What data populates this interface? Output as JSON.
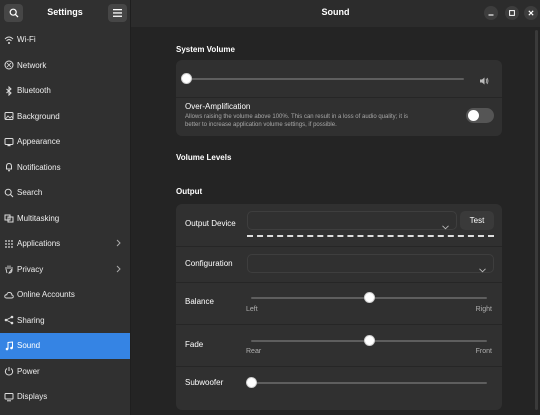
{
  "sidebar": {
    "title": "Settings",
    "items": [
      {
        "label": "Wi-Fi",
        "icon": "wifi-icon"
      },
      {
        "label": "Network",
        "icon": "network-icon"
      },
      {
        "label": "Bluetooth",
        "icon": "bluetooth-icon"
      },
      {
        "label": "Background",
        "icon": "background-icon"
      },
      {
        "label": "Appearance",
        "icon": "appearance-icon"
      },
      {
        "label": "Notifications",
        "icon": "bell-icon"
      },
      {
        "label": "Search",
        "icon": "search-icon"
      },
      {
        "label": "Multitasking",
        "icon": "multitasking-icon"
      },
      {
        "label": "Applications",
        "icon": "apps-grid-icon"
      },
      {
        "label": "Privacy",
        "icon": "hand-icon"
      },
      {
        "label": "Online Accounts",
        "icon": "cloud-icon"
      },
      {
        "label": "Sharing",
        "icon": "share-icon"
      },
      {
        "label": "Sound",
        "icon": "music-note-icon"
      },
      {
        "label": "Power",
        "icon": "power-icon"
      },
      {
        "label": "Displays",
        "icon": "display-icon"
      }
    ],
    "active": "Sound"
  },
  "window": {
    "title": "Sound"
  },
  "system_volume": {
    "heading": "System Volume",
    "level": 0,
    "over_amp_title": "Over-Amplification",
    "over_amp_desc_1": "Allows raising the volume above 100%. This can result in a loss of audio quality; it is",
    "over_amp_desc_2": "better to increase application volume settings, if possible.",
    "over_amp_enabled": false
  },
  "volume_levels": {
    "heading": "Volume Levels"
  },
  "output": {
    "heading": "Output",
    "device_label": "Output Device",
    "device_value": "",
    "test_label": "Test",
    "config_label": "Configuration",
    "config_value": "",
    "balance_label": "Balance",
    "balance_left": "Left",
    "balance_right": "Right",
    "balance_value": 0.5,
    "fade_label": "Fade",
    "fade_rear": "Rear",
    "fade_front": "Front",
    "fade_value": 0.5,
    "subwoofer_label": "Subwoofer",
    "subwoofer_value": 0
  },
  "colors": {
    "accent": "#3584e4",
    "sidebar_bg": "#303030",
    "content_bg": "#242424",
    "card_bg": "#303030"
  }
}
